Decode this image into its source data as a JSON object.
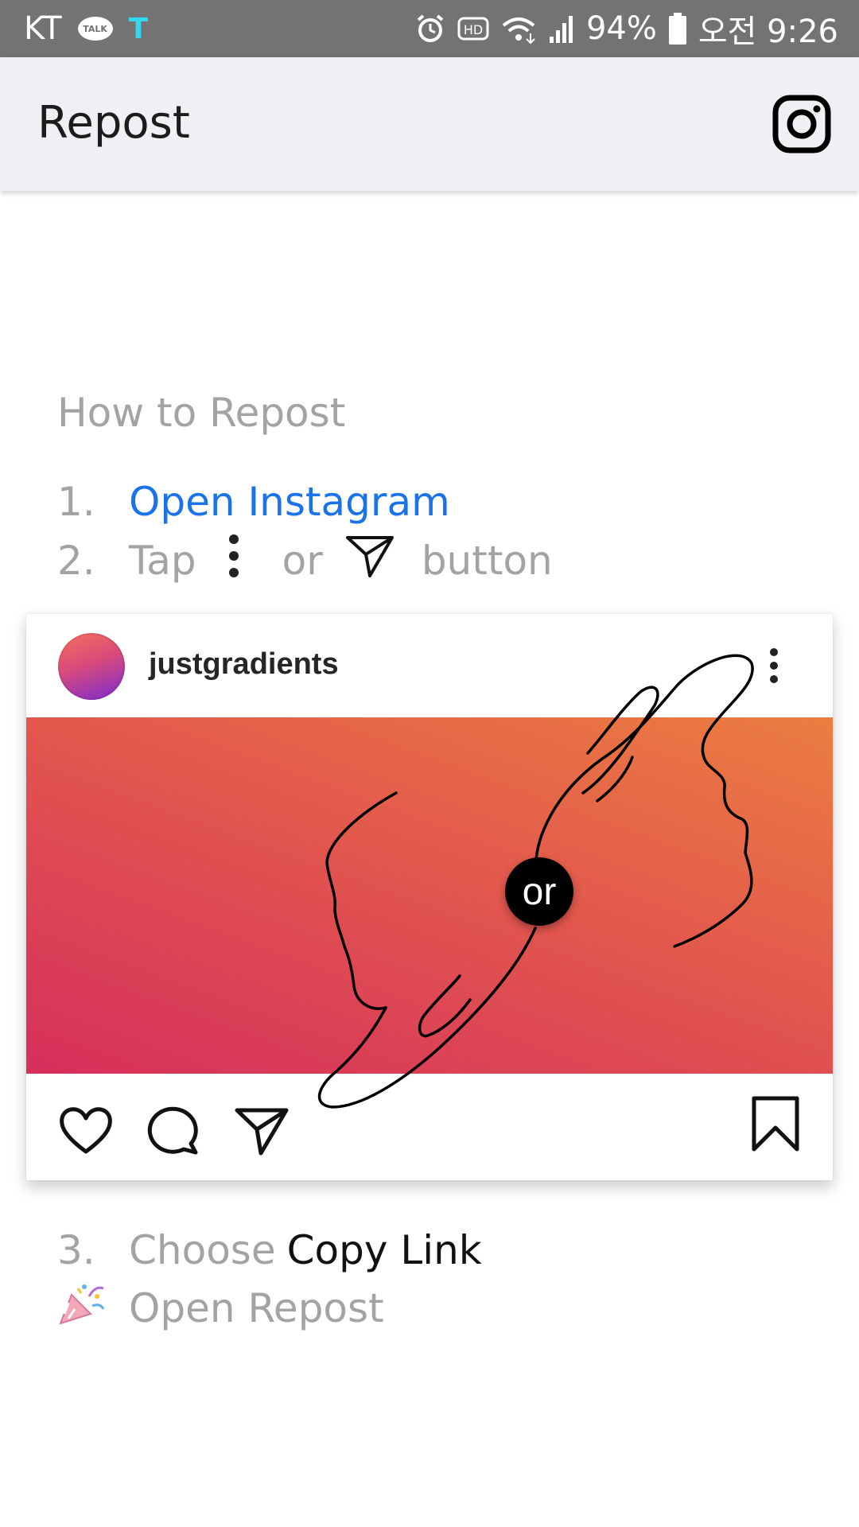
{
  "status_bar": {
    "carrier": "KT",
    "talk_label": "TALK",
    "t_label": "T",
    "battery_percent": "94%",
    "time": "오전 9:26",
    "icons": [
      "alarm-icon",
      "hd-icon",
      "wifi-icon",
      "signal-icon",
      "battery-icon"
    ]
  },
  "appbar": {
    "title": "Repost",
    "action_icon": "instagram-icon"
  },
  "instructions": {
    "heading": "How to Repost",
    "step1": {
      "number": "1.",
      "label": "Open Instagram"
    },
    "step2": {
      "number": "2.",
      "prefix": "Tap",
      "or": "or",
      "suffix": "button"
    },
    "step3": {
      "number": "3.",
      "prefix": "Choose",
      "highlight": "Copy Link"
    },
    "step4": {
      "icon": "party-popper-icon",
      "label": "Open Repost"
    }
  },
  "card": {
    "username": "justgradients",
    "or_badge": "or",
    "actions": [
      "heart-icon",
      "comment-icon",
      "share-icon",
      "bookmark-icon"
    ]
  },
  "colors": {
    "status_bar": "#737373",
    "appbar": "#efeff4",
    "link": "#1a73e8",
    "muted_text": "#a3a3a3",
    "gradient_start": "#d62f5c",
    "gradient_end": "#ec7d40"
  }
}
